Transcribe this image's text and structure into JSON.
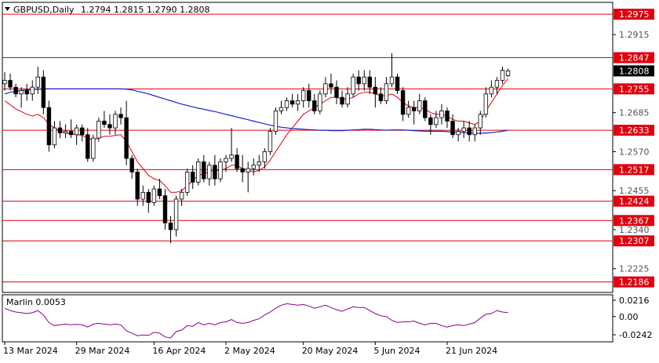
{
  "header": {
    "symbol": "GBPUSD,Daily",
    "ohlc": "1.2794 1.2815 1.2790 1.2808"
  },
  "indicator": {
    "label": "Marlin 0.0053",
    "ticks": [
      "0.0216",
      "0.00",
      "-0.0242"
    ]
  },
  "colors": {
    "bull": "#ffffff",
    "bear": "#000000",
    "wick": "#000000",
    "ma_fast": "#e0000e",
    "ma_slow": "#1a23c8",
    "level": "#e0000e",
    "marlin": "#8b008b",
    "price_tag": "#000000",
    "level_tag": "#e0000e"
  },
  "chart_data": [
    {
      "type": "candlestick",
      "symbol": "GBPUSD",
      "timeframe": "Daily",
      "ylim": [
        1.2155,
        1.301
      ],
      "y_ticks": [
        "1.2915",
        "1.2685",
        "1.2570",
        "1.2455",
        "1.2340",
        "1.2225"
      ],
      "x_ticks": [
        "13 Mar 2024",
        "29 Mar 2024",
        "16 Apr 2024",
        "2 May 2024",
        "20 May 2024",
        "5 Jun 2024",
        "21 Jun 2024"
      ],
      "x_tick_bar_index": [
        0,
        13,
        27,
        40,
        54,
        67,
        80
      ],
      "current_price": "1.2808",
      "levels": [
        "1.2975",
        "1.2847",
        "1.2755",
        "1.2633",
        "1.2517",
        "1.2424",
        "1.2367",
        "1.2307",
        "1.2186"
      ],
      "candles": [
        [
          1.277,
          1.2804,
          1.275,
          1.278
        ],
        [
          1.278,
          1.28,
          1.275,
          1.276
        ],
        [
          1.276,
          1.277,
          1.273,
          1.274
        ],
        [
          1.274,
          1.276,
          1.27,
          1.275
        ],
        [
          1.275,
          1.277,
          1.272,
          1.274
        ],
        [
          1.274,
          1.278,
          1.272,
          1.276
        ],
        [
          1.276,
          1.282,
          1.274,
          1.279
        ],
        [
          1.279,
          1.281,
          1.268,
          1.27
        ],
        [
          1.27,
          1.272,
          1.257,
          1.259
        ],
        [
          1.259,
          1.266,
          1.258,
          1.264
        ],
        [
          1.264,
          1.266,
          1.261,
          1.2625
        ],
        [
          1.2625,
          1.265,
          1.261,
          1.263
        ],
        [
          1.263,
          1.2665,
          1.261,
          1.262
        ],
        [
          1.262,
          1.265,
          1.259,
          1.264
        ],
        [
          1.264,
          1.265,
          1.26,
          1.262
        ],
        [
          1.262,
          1.264,
          1.254,
          1.255
        ],
        [
          1.255,
          1.262,
          1.254,
          1.261
        ],
        [
          1.261,
          1.267,
          1.26,
          1.266
        ],
        [
          1.266,
          1.269,
          1.264,
          1.265
        ],
        [
          1.265,
          1.268,
          1.262,
          1.264
        ],
        [
          1.264,
          1.269,
          1.262,
          1.268
        ],
        [
          1.268,
          1.27,
          1.265,
          1.267
        ],
        [
          1.267,
          1.272,
          1.253,
          1.255
        ],
        [
          1.255,
          1.256,
          1.249,
          1.251
        ],
        [
          1.251,
          1.252,
          1.241,
          1.243
        ],
        [
          1.243,
          1.247,
          1.241,
          1.245
        ],
        [
          1.245,
          1.246,
          1.239,
          1.242
        ],
        [
          1.242,
          1.247,
          1.241,
          1.246
        ],
        [
          1.246,
          1.249,
          1.243,
          1.244
        ],
        [
          1.244,
          1.246,
          1.234,
          1.236
        ],
        [
          1.236,
          1.238,
          1.23,
          1.234
        ],
        [
          1.234,
          1.244,
          1.232,
          1.243
        ],
        [
          1.243,
          1.246,
          1.241,
          1.245
        ],
        [
          1.245,
          1.252,
          1.244,
          1.251
        ],
        [
          1.251,
          1.253,
          1.246,
          1.248
        ],
        [
          1.248,
          1.255,
          1.247,
          1.254
        ],
        [
          1.254,
          1.256,
          1.248,
          1.249
        ],
        [
          1.249,
          1.254,
          1.247,
          1.253
        ],
        [
          1.253,
          1.256,
          1.247,
          1.249
        ],
        [
          1.249,
          1.255,
          1.248,
          1.254
        ],
        [
          1.254,
          1.256,
          1.251,
          1.255
        ],
        [
          1.255,
          1.264,
          1.254,
          1.256
        ],
        [
          1.256,
          1.258,
          1.251,
          1.252
        ],
        [
          1.252,
          1.256,
          1.248,
          1.251
        ],
        [
          1.251,
          1.254,
          1.245,
          1.252
        ],
        [
          1.252,
          1.255,
          1.25,
          1.253
        ],
        [
          1.253,
          1.256,
          1.251,
          1.254
        ],
        [
          1.254,
          1.258,
          1.252,
          1.257
        ],
        [
          1.257,
          1.264,
          1.256,
          1.263
        ],
        [
          1.263,
          1.27,
          1.262,
          1.269
        ],
        [
          1.269,
          1.272,
          1.268,
          1.27
        ],
        [
          1.27,
          1.273,
          1.269,
          1.272
        ],
        [
          1.272,
          1.274,
          1.27,
          1.271
        ],
        [
          1.271,
          1.274,
          1.269,
          1.272
        ],
        [
          1.272,
          1.276,
          1.27,
          1.275
        ],
        [
          1.275,
          1.277,
          1.27,
          1.272
        ],
        [
          1.272,
          1.274,
          1.268,
          1.269
        ],
        [
          1.269,
          1.275,
          1.268,
          1.274
        ],
        [
          1.274,
          1.279,
          1.273,
          1.277
        ],
        [
          1.277,
          1.28,
          1.274,
          1.276
        ],
        [
          1.276,
          1.278,
          1.271,
          1.273
        ],
        [
          1.273,
          1.275,
          1.27,
          1.271
        ],
        [
          1.271,
          1.276,
          1.27,
          1.274
        ],
        [
          1.274,
          1.28,
          1.273,
          1.279
        ],
        [
          1.279,
          1.281,
          1.275,
          1.277
        ],
        [
          1.277,
          1.281,
          1.275,
          1.279
        ],
        [
          1.279,
          1.281,
          1.274,
          1.276
        ],
        [
          1.276,
          1.279,
          1.27,
          1.274
        ],
        [
          1.274,
          1.276,
          1.271,
          1.272
        ],
        [
          1.272,
          1.279,
          1.271,
          1.277
        ],
        [
          1.277,
          1.286,
          1.276,
          1.279
        ],
        [
          1.279,
          1.28,
          1.274,
          1.275
        ],
        [
          1.275,
          1.276,
          1.266,
          1.268
        ],
        [
          1.268,
          1.272,
          1.267,
          1.27
        ],
        [
          1.27,
          1.272,
          1.265,
          1.269
        ],
        [
          1.269,
          1.274,
          1.268,
          1.272
        ],
        [
          1.272,
          1.273,
          1.266,
          1.267
        ],
        [
          1.267,
          1.268,
          1.262,
          1.265
        ],
        [
          1.265,
          1.269,
          1.264,
          1.267
        ],
        [
          1.267,
          1.271,
          1.265,
          1.269
        ],
        [
          1.269,
          1.27,
          1.264,
          1.266
        ],
        [
          1.266,
          1.268,
          1.261,
          1.262
        ],
        [
          1.262,
          1.264,
          1.26,
          1.263
        ],
        [
          1.263,
          1.266,
          1.261,
          1.264
        ],
        [
          1.264,
          1.266,
          1.26,
          1.262
        ],
        [
          1.262,
          1.265,
          1.26,
          1.264
        ],
        [
          1.264,
          1.269,
          1.262,
          1.268
        ],
        [
          1.268,
          1.276,
          1.267,
          1.274
        ],
        [
          1.274,
          1.278,
          1.273,
          1.276
        ],
        [
          1.276,
          1.279,
          1.274,
          1.278
        ],
        [
          1.278,
          1.282,
          1.277,
          1.281
        ],
        [
          1.2794,
          1.2815,
          1.279,
          1.2808
        ]
      ],
      "ma_fast": [
        1.272,
        1.2708,
        1.2696,
        1.2688,
        1.268,
        1.2675,
        1.268,
        1.267,
        1.265,
        1.264,
        1.263,
        1.2625,
        1.2622,
        1.262,
        1.2618,
        1.261,
        1.2605,
        1.261,
        1.2615,
        1.2615,
        1.2618,
        1.262,
        1.26,
        1.257,
        1.254,
        1.252,
        1.25,
        1.249,
        1.2485,
        1.247,
        1.245,
        1.245,
        1.2455,
        1.247,
        1.2485,
        1.25,
        1.2505,
        1.251,
        1.2515,
        1.2515,
        1.252,
        1.253,
        1.253,
        1.252,
        1.2515,
        1.251,
        1.2515,
        1.2525,
        1.2545,
        1.257,
        1.2595,
        1.262,
        1.264,
        1.266,
        1.268,
        1.269,
        1.27,
        1.271,
        1.272,
        1.273,
        1.273,
        1.2725,
        1.2725,
        1.273,
        1.274,
        1.2745,
        1.2745,
        1.274,
        1.2735,
        1.2735,
        1.274,
        1.273,
        1.2715,
        1.2705,
        1.27,
        1.27,
        1.2695,
        1.2685,
        1.268,
        1.268,
        1.2675,
        1.2665,
        1.266,
        1.266,
        1.2655,
        1.265,
        1.266,
        1.269,
        1.2715,
        1.274,
        1.2765,
        1.2785
      ],
      "ma_slow": [
        1.274,
        1.2745,
        1.2748,
        1.275,
        1.2752,
        1.2753,
        1.2754,
        1.2755,
        1.2755,
        1.2755,
        1.2755,
        1.2755,
        1.2755,
        1.2755,
        1.2755,
        1.2755,
        1.2755,
        1.2755,
        1.2755,
        1.2755,
        1.2755,
        1.2755,
        1.2754,
        1.2752,
        1.2748,
        1.2744,
        1.274,
        1.2735,
        1.273,
        1.2725,
        1.272,
        1.2715,
        1.271,
        1.2706,
        1.2702,
        1.2698,
        1.2695,
        1.2691,
        1.2688,
        1.2684,
        1.268,
        1.2676,
        1.2672,
        1.2668,
        1.2664,
        1.266,
        1.2656,
        1.2652,
        1.2648,
        1.2645,
        1.2642,
        1.264,
        1.2638,
        1.2637,
        1.2636,
        1.2635,
        1.2634,
        1.2633,
        1.2633,
        1.2632,
        1.2632,
        1.2632,
        1.2633,
        1.2634,
        1.2635,
        1.2636,
        1.2636,
        1.2635,
        1.2634,
        1.2633,
        1.2634,
        1.2634,
        1.2634,
        1.2633,
        1.2632,
        1.2631,
        1.263,
        1.263,
        1.263,
        1.263,
        1.2629,
        1.2628,
        1.2627,
        1.2626,
        1.2625,
        1.2624,
        1.2624,
        1.2625,
        1.2626,
        1.2628,
        1.263,
        1.2633
      ],
      "marlin": [
        0.011,
        0.008,
        0.006,
        0.005,
        0.004,
        0.005,
        0.008,
        0.002,
        -0.008,
        -0.012,
        -0.011,
        -0.01,
        -0.011,
        -0.0105,
        -0.011,
        -0.014,
        -0.01,
        -0.009,
        -0.01,
        -0.011,
        -0.01,
        -0.011,
        -0.019,
        -0.022,
        -0.0255,
        -0.0245,
        -0.025,
        -0.021,
        -0.022,
        -0.027,
        -0.0285,
        -0.02,
        -0.018,
        -0.012,
        -0.013,
        -0.008,
        -0.011,
        -0.009,
        -0.011,
        -0.008,
        -0.007,
        -0.004,
        -0.008,
        -0.009,
        -0.008,
        -0.005,
        -0.003,
        0.002,
        0.006,
        0.011,
        0.015,
        0.017,
        0.016,
        0.015,
        0.016,
        0.014,
        0.011,
        0.013,
        0.015,
        0.012,
        0.009,
        0.007,
        0.01,
        0.013,
        0.012,
        0.012,
        0.008,
        0.004,
        0.001,
        0.0,
        -0.005,
        -0.008,
        -0.007,
        -0.007,
        -0.006,
        -0.009,
        -0.011,
        -0.009,
        -0.009,
        -0.012,
        -0.014,
        -0.012,
        -0.011,
        -0.012,
        -0.01,
        -0.008,
        -0.002,
        0.003,
        0.004,
        0.008,
        0.006,
        0.0053
      ]
    }
  ]
}
